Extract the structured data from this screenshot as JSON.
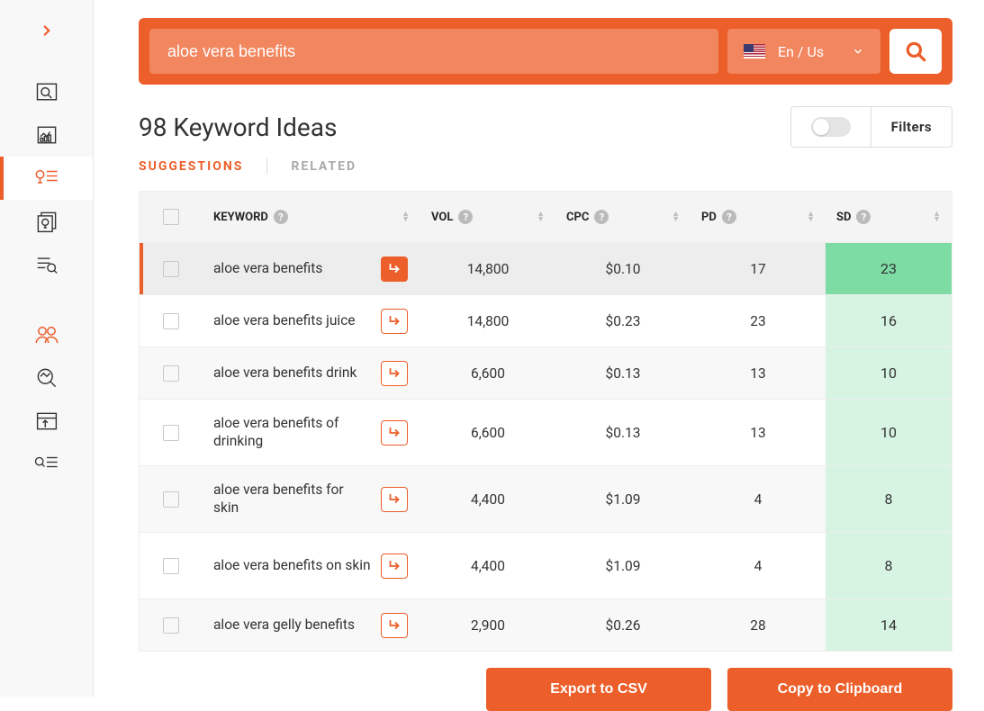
{
  "search": {
    "value": "aloe vera benefits"
  },
  "region": {
    "label": "En / Us"
  },
  "header": {
    "title": "98 Keyword Ideas",
    "filters_label": "Filters"
  },
  "tabs": {
    "suggestions": "SUGGESTIONS",
    "related": "RELATED"
  },
  "columns": {
    "keyword": "KEYWORD",
    "vol": "VOL",
    "cpc": "CPC",
    "pd": "PD",
    "sd": "SD"
  },
  "rows": [
    {
      "keyword": "aloe vera benefits",
      "vol": "14,800",
      "cpc": "$0.10",
      "pd": "17",
      "sd": "23",
      "selected": true,
      "go_filled": true,
      "sd_class": "strong"
    },
    {
      "keyword": "aloe vera benefits juice",
      "vol": "14,800",
      "cpc": "$0.23",
      "pd": "23",
      "sd": "16",
      "sd_class": "light"
    },
    {
      "keyword": "aloe vera benefits drink",
      "vol": "6,600",
      "cpc": "$0.13",
      "pd": "13",
      "sd": "10",
      "sd_class": "light"
    },
    {
      "keyword": "aloe vera benefits of drinking",
      "vol": "6,600",
      "cpc": "$0.13",
      "pd": "13",
      "sd": "10",
      "sd_class": "light",
      "tall": true
    },
    {
      "keyword": "aloe vera benefits for skin",
      "vol": "4,400",
      "cpc": "$1.09",
      "pd": "4",
      "sd": "8",
      "sd_class": "light",
      "tall": true
    },
    {
      "keyword": "aloe vera benefits on skin",
      "vol": "4,400",
      "cpc": "$1.09",
      "pd": "4",
      "sd": "8",
      "sd_class": "light",
      "tall": true
    },
    {
      "keyword": "aloe vera gelly benefits",
      "vol": "2,900",
      "cpc": "$0.26",
      "pd": "28",
      "sd": "14",
      "sd_class": "light"
    }
  ],
  "actions": {
    "export": "Export to CSV",
    "copy": "Copy to Clipboard"
  },
  "icons": {
    "help_glyph": "?"
  }
}
